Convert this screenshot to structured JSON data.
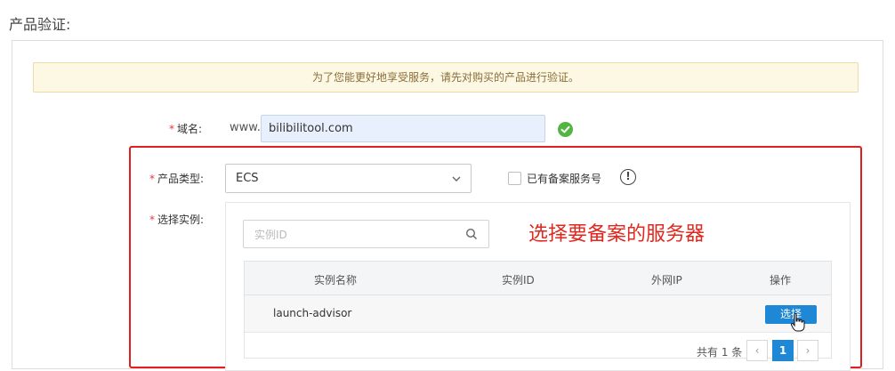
{
  "page_title": "产品验证:",
  "notice": "为了您能更好地享受服务，请先对购买的产品进行验证。",
  "required_mark": "*",
  "domain": {
    "label": "域名:",
    "prefix": "www.",
    "value": "bilibilitool.com",
    "status_icon": "check-circle-icon"
  },
  "product_type": {
    "label": "产品类型:",
    "selected": "ECS"
  },
  "record_service_checkbox": {
    "label": "已有备案服务号",
    "checked": false
  },
  "info_icon_glyph": "!",
  "instance": {
    "label": "选择实例:",
    "search_placeholder": "实例ID",
    "annotation": "选择要备案的服务器"
  },
  "table": {
    "columns": [
      "实例名称",
      "实例ID",
      "外网IP",
      "操作"
    ],
    "rows": [
      {
        "name": "launch-advisor",
        "id": "",
        "ip": "",
        "action": "选择"
      }
    ]
  },
  "pagination": {
    "total_text": "共有 1 条",
    "prev": "‹",
    "current_page": "1",
    "next": "›"
  },
  "colors": {
    "primary": "#1e88d6",
    "annotation_red": "#e0281f",
    "success_green": "#52b541",
    "notice_bg": "#fdf8e4"
  }
}
